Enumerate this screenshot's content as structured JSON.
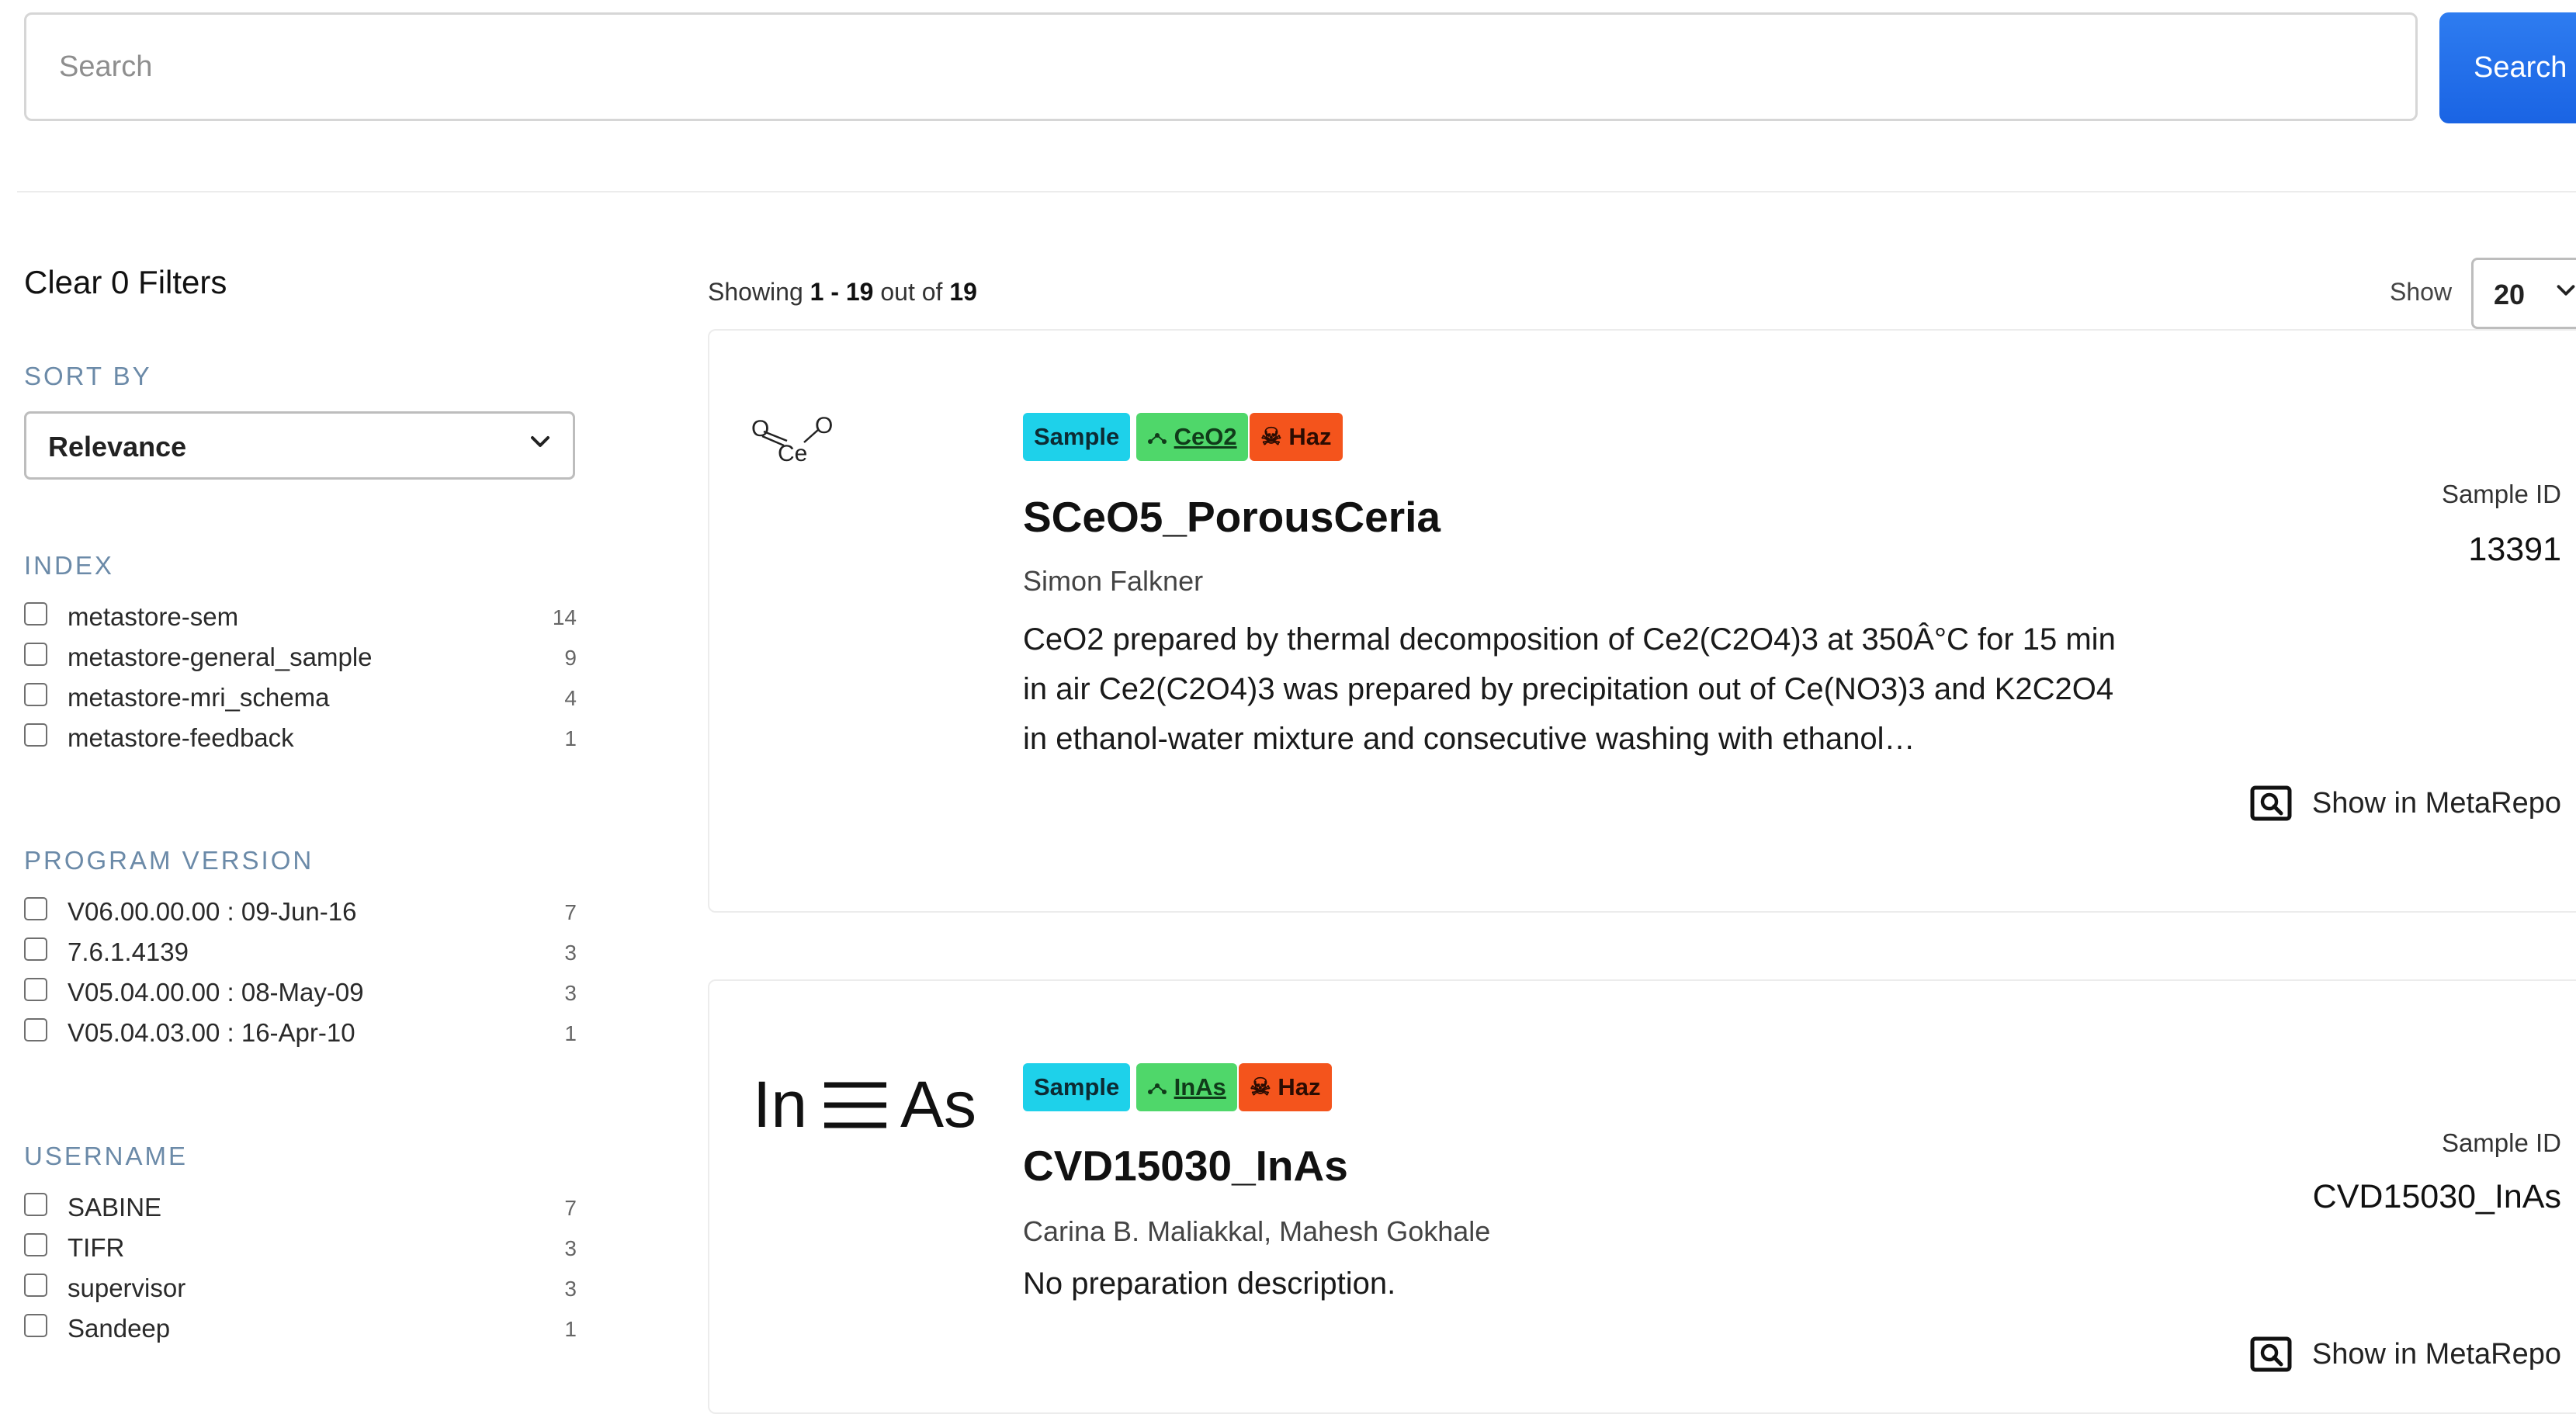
{
  "search": {
    "placeholder": "Search",
    "button_label": "Search"
  },
  "sidebar": {
    "clear_filters": "Clear 0 Filters",
    "sort": {
      "title": "SORT BY",
      "selected": "Relevance"
    },
    "facets": [
      {
        "title": "INDEX",
        "items": [
          {
            "label": "metastore-sem",
            "count": "14"
          },
          {
            "label": "metastore-general_sample",
            "count": "9"
          },
          {
            "label": "metastore-mri_schema",
            "count": "4"
          },
          {
            "label": "metastore-feedback",
            "count": "1"
          }
        ]
      },
      {
        "title": "PROGRAM VERSION",
        "items": [
          {
            "label": "V06.00.00.00 : 09-Jun-16",
            "count": "7"
          },
          {
            "label": "7.6.1.4139",
            "count": "3"
          },
          {
            "label": "V05.04.00.00 : 08-May-09",
            "count": "3"
          },
          {
            "label": "V05.04.03.00 : 16-Apr-10",
            "count": "1"
          }
        ]
      },
      {
        "title": "USERNAME",
        "items": [
          {
            "label": "SABINE",
            "count": "7"
          },
          {
            "label": "TIFR",
            "count": "3"
          },
          {
            "label": "supervisor",
            "count": "3"
          },
          {
            "label": "Sandeep",
            "count": "1"
          }
        ]
      }
    ]
  },
  "results": {
    "showing_prefix": "Showing",
    "range": "1 - 19",
    "out_of": "out of",
    "total": "19",
    "show_label": "Show",
    "page_size": "20",
    "items": [
      {
        "structure": {
          "atoms": [
            "O",
            "Ce",
            "O"
          ],
          "icon": "ceo2-structure"
        },
        "badges": {
          "sample": "Sample",
          "formula": "CeO2",
          "haz": "Haz"
        },
        "title": "SCeO5_PorousCeria",
        "authors": "Simon Falkner",
        "description": "CeO2 prepared by thermal decomposition of Ce2(C2O4)3 at 350Â°C for 15 min in air Ce2(C2O4)3 was prepared by precipitation out of Ce(NO3)3 and K2C2O4 in ethanol-water mixture and consecutive washing with ethanol…",
        "sample_id_label": "Sample ID",
        "sample_id": "13391",
        "action": "Show in MetaRepo"
      },
      {
        "structure": {
          "atoms": [
            "In",
            "As"
          ],
          "icon": "inas-triple-bond"
        },
        "badges": {
          "sample": "Sample",
          "formula": "InAs",
          "haz": "Haz"
        },
        "title": "CVD15030_InAs",
        "authors": "Carina B. Maliakkal, Mahesh Gokhale",
        "description": "No preparation description.",
        "sample_id_label": "Sample ID",
        "sample_id": "CVD15030_InAs",
        "action": "Show in MetaRepo"
      }
    ]
  },
  "colors": {
    "search_button": "#1a64e4",
    "badge_sample": "#1ed1ea",
    "badge_formula": "#4fd76a",
    "badge_haz": "#f4541c",
    "facet_title": "#6b8aa8"
  }
}
